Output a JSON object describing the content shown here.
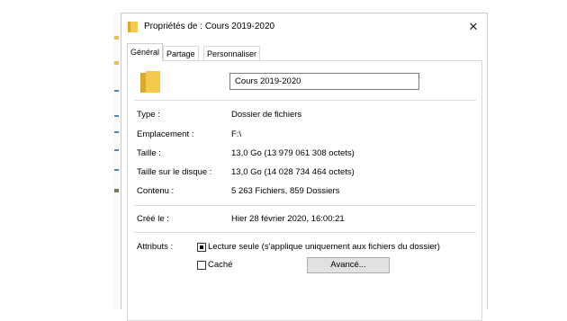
{
  "window": {
    "title": "Propriétés de : Cours 2019-2020",
    "close_glyph": "✕"
  },
  "tabs": [
    {
      "label": "Général",
      "active": true
    },
    {
      "label": "Partage",
      "active": false
    },
    {
      "label": "Personnaliser",
      "active": false
    }
  ],
  "general": {
    "folder_name": "Cours 2019-2020",
    "type": {
      "label": "Type :",
      "value": "Dossier de fichiers"
    },
    "location": {
      "label": "Emplacement :",
      "value": "F:\\"
    },
    "size": {
      "label": "Taille :",
      "value": "13,0 Go (13 979 061 308 octets)"
    },
    "size_on_disk": {
      "label": "Taille sur le disque :",
      "value": "13,0 Go (14 028 734 464 octets)"
    },
    "contents": {
      "label": "Contenu :",
      "value": "5 263 Fichiers, 859 Dossiers"
    },
    "created": {
      "label": "Créé le :",
      "value": "Hier 28 février 2020, 16:00:21"
    },
    "attributes": {
      "label": "Attributs :",
      "readonly": {
        "label": "Lecture seule (s'applique uniquement aux fichiers du dossier)",
        "state": "indeterminate"
      },
      "hidden": {
        "label": "Caché",
        "checked": false
      },
      "advanced_button": "Avancé..."
    }
  },
  "colors": {
    "folder_yellow": "#f3c94e",
    "folder_dark": "#dcab2e"
  },
  "icons": [
    "folder-icon",
    "close-icon",
    "checkbox-indeterminate-icon"
  ]
}
